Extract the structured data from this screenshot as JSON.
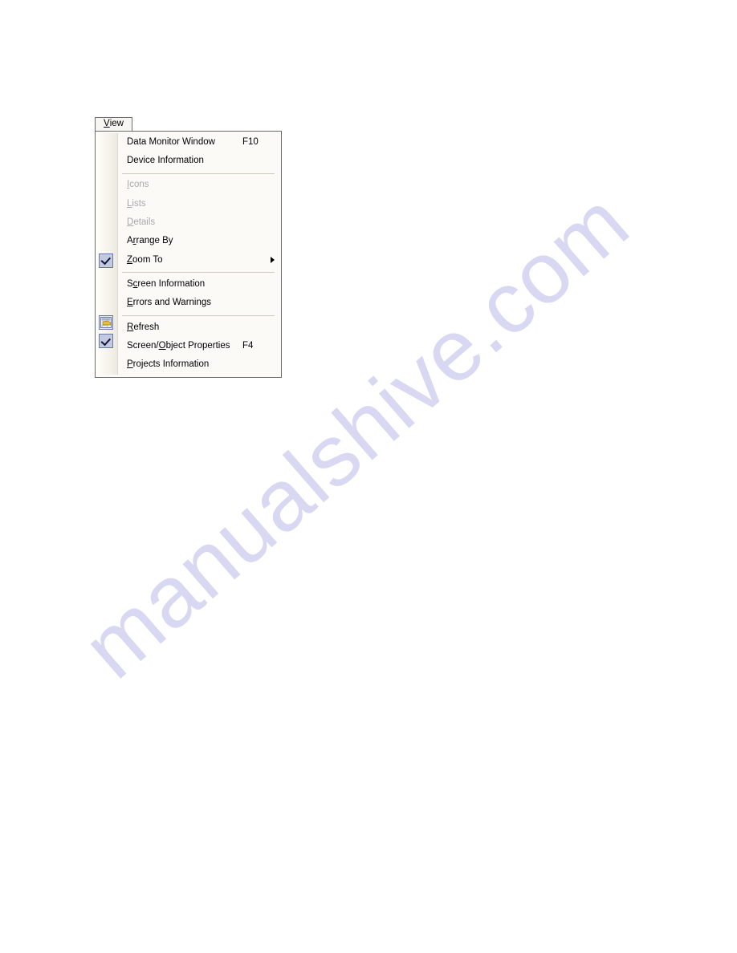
{
  "page": {
    "background": "#ffffff",
    "watermark_text": "manualshive.com",
    "watermark_color": "#d8d8f2"
  },
  "menubar": {
    "tab": {
      "name": "View",
      "accel_char": "V",
      "label_rest": "iew"
    }
  },
  "menu": {
    "panel_background": "#fbfaf7",
    "border_color": "#6b6b6b",
    "separator_color": "#cfccc2",
    "check_box_border": "#6a77a8",
    "check_box_fill": "#c3cadf",
    "items": [
      {
        "id": "data-monitor-window",
        "accel": "",
        "label": "Data Monitor Window",
        "shortcut": "F10",
        "disabled": false,
        "checked": false,
        "submenu": false,
        "icon": ""
      },
      {
        "id": "device-information",
        "accel": "",
        "label": "Device Information",
        "shortcut": "",
        "disabled": false,
        "checked": false,
        "submenu": false,
        "icon": ""
      },
      {
        "id": "separator-1",
        "type": "separator"
      },
      {
        "id": "icons",
        "accel": "I",
        "label_rest": "cons",
        "label": "Icons",
        "shortcut": "",
        "disabled": true,
        "checked": false,
        "submenu": false,
        "icon": ""
      },
      {
        "id": "lists",
        "accel": "L",
        "label_rest": "ists",
        "label": "Lists",
        "shortcut": "",
        "disabled": true,
        "checked": false,
        "submenu": false,
        "icon": ""
      },
      {
        "id": "details",
        "accel": "D",
        "label_rest": "etails",
        "label": "Details",
        "shortcut": "",
        "disabled": true,
        "checked": false,
        "submenu": false,
        "icon": ""
      },
      {
        "id": "arrange-by",
        "accel_pre": "A",
        "accel": "r",
        "label_rest": "range By",
        "label": "Arrange By",
        "shortcut": "",
        "disabled": false,
        "checked": false,
        "submenu": false,
        "icon": ""
      },
      {
        "id": "zoom-to",
        "accel": "Z",
        "label_rest": "oom To",
        "label": "Zoom To",
        "shortcut": "",
        "disabled": false,
        "checked": false,
        "submenu": true,
        "icon": "submenu-arrow-icon"
      },
      {
        "id": "separator-2",
        "type": "separator"
      },
      {
        "id": "screen-information",
        "accel_pre": "S",
        "accel": "c",
        "label_rest": "reen Information",
        "label": "Screen Information",
        "shortcut": "",
        "disabled": false,
        "checked": true,
        "submenu": false,
        "icon": "checkmark-icon"
      },
      {
        "id": "errors-and-warnings",
        "accel": "E",
        "label_rest": "rrors and Warnings",
        "label": "Errors and Warnings",
        "shortcut": "",
        "disabled": false,
        "checked": false,
        "submenu": false,
        "icon": ""
      },
      {
        "id": "separator-3",
        "type": "separator"
      },
      {
        "id": "refresh",
        "accel": "R",
        "label_rest": "efresh",
        "label": "Refresh",
        "shortcut": "",
        "disabled": false,
        "checked": false,
        "submenu": false,
        "icon": ""
      },
      {
        "id": "screen-object-properties",
        "accel_pre": "Screen/",
        "accel": "O",
        "label_rest": "bject Properties",
        "label": "Screen/Object Properties",
        "shortcut": "F4",
        "disabled": false,
        "checked": false,
        "submenu": false,
        "icon": "properties-window-icon"
      },
      {
        "id": "projects-information",
        "accel": "P",
        "label_rest": "rojects Information",
        "label": "Projects Information",
        "shortcut": "",
        "disabled": false,
        "checked": true,
        "submenu": false,
        "icon": "checkmark-icon"
      }
    ]
  }
}
